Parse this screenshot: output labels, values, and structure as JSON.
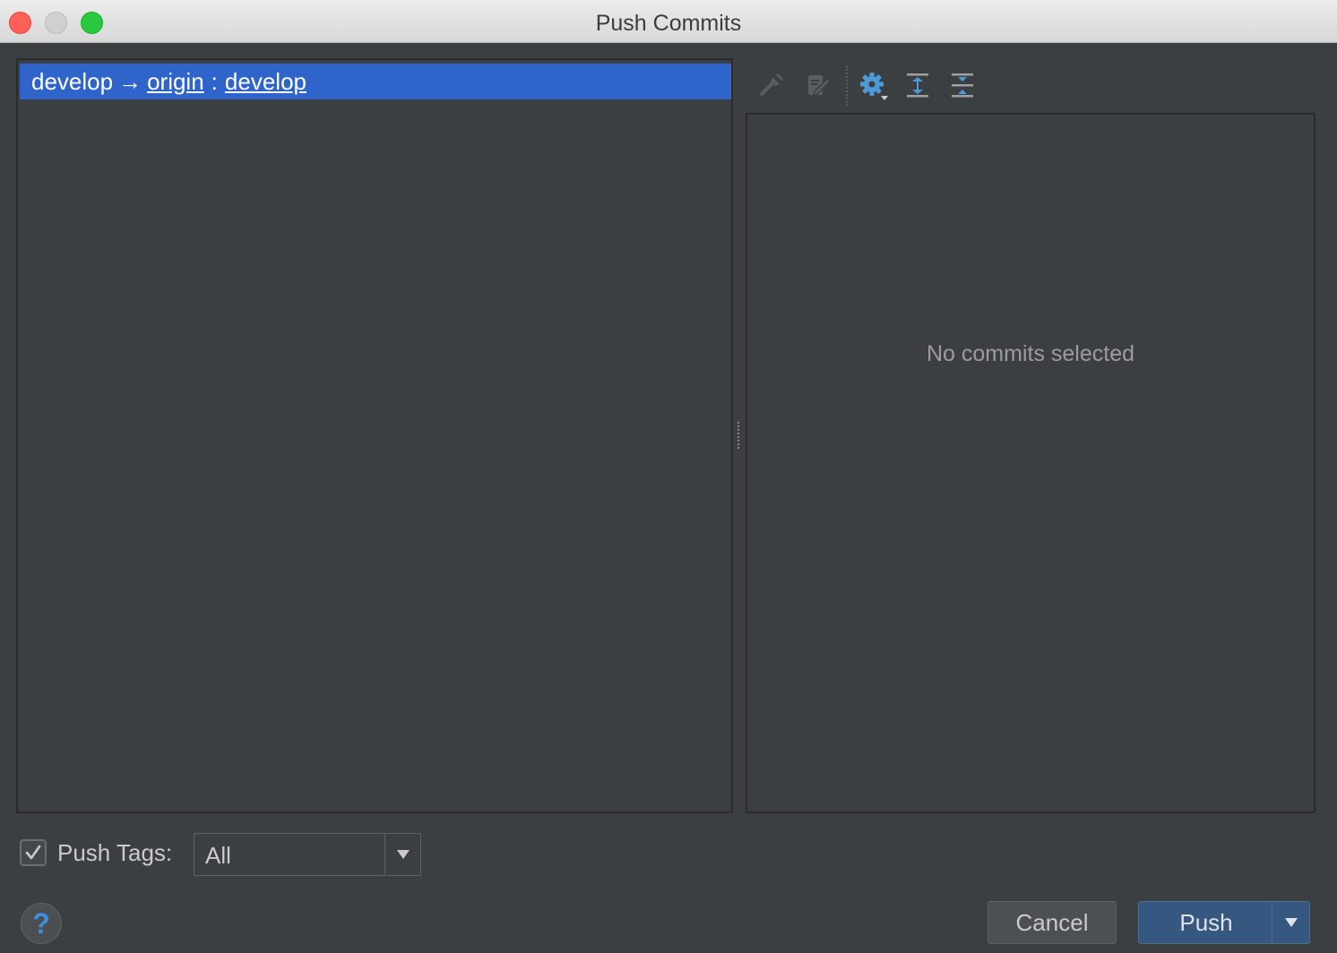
{
  "window": {
    "title": "Push Commits"
  },
  "repositories": {
    "row": {
      "local_branch": "develop",
      "arrow": "→",
      "remote": "origin",
      "separator": ":",
      "remote_branch": "develop"
    }
  },
  "toolbar": {
    "items": [
      {
        "name": "cherry-pick-icon",
        "enabled": false
      },
      {
        "name": "edit-source-icon",
        "enabled": false
      },
      {
        "name": "settings-icon",
        "enabled": true
      },
      {
        "name": "expand-all-icon",
        "enabled": true
      },
      {
        "name": "collapse-all-icon",
        "enabled": true
      }
    ]
  },
  "details": {
    "empty_text": "No commits selected"
  },
  "push_tags": {
    "checked": true,
    "label": "Push Tags:",
    "selected": "All"
  },
  "buttons": {
    "help": "?",
    "cancel": "Cancel",
    "push": "Push"
  },
  "colors": {
    "selection": "#2f65ca",
    "background": "#3c3f41",
    "accent_icon": "#4d9ad7",
    "primary_button": "#365880"
  }
}
